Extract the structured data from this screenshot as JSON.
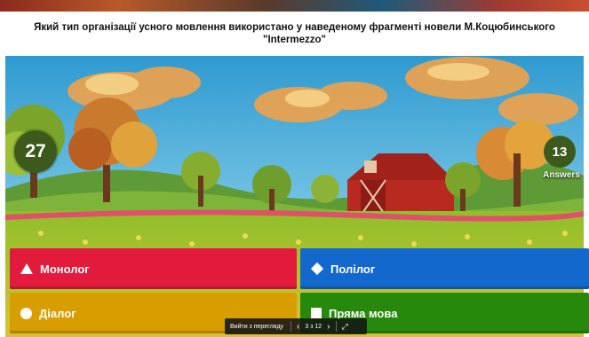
{
  "question": {
    "line1": "Який тип організації усного мовлення використано у наведеному фрагменті новели М.Коцюбинського",
    "line2": "\"Intermezzo\""
  },
  "timer": {
    "value": "27"
  },
  "answers": {
    "count": "13",
    "label": "Answers"
  },
  "options": [
    {
      "label": "Монолог",
      "color": "#e21b3c",
      "shape": "triangle"
    },
    {
      "label": "Полілог",
      "color": "#1368ce",
      "shape": "diamond"
    },
    {
      "label": "Діалог",
      "color": "#d89e00",
      "shape": "circle"
    },
    {
      "label": "Пряма мова",
      "color": "#26890c",
      "shape": "square"
    }
  ],
  "player_controls": {
    "fullscreen_label": "Вийти з перегляду",
    "prev_icon": "chevron-left-icon",
    "page_indicator": "3 з 12",
    "next_icon": "chevron-right-icon",
    "expand_icon": "expand-icon"
  }
}
